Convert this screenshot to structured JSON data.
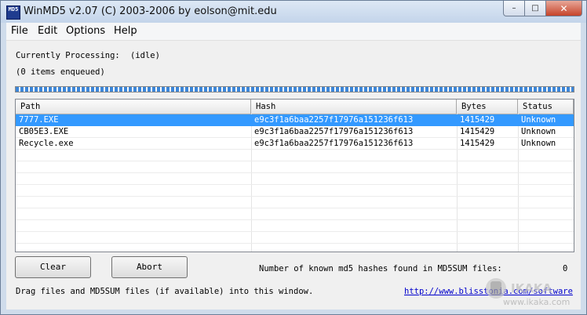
{
  "window": {
    "title": "WinMD5 v2.07 (C) 2003-2006 by eolson@mit.edu",
    "app_icon_text": "MD5"
  },
  "menu": [
    "File",
    "Edit",
    "Options",
    "Help"
  ],
  "status": {
    "processing_label": "Currently Processing:",
    "processing_value": "(idle)",
    "queue": "(0 items enqueued)",
    "progress_fraction": 1.0
  },
  "table": {
    "columns": [
      "Path",
      "Hash",
      "Bytes",
      "Status"
    ],
    "rows": [
      {
        "path": "7777.EXE",
        "hash": "e9c3f1a6baa2257f17976a151236f613",
        "bytes": "1415429",
        "status": "Unknown",
        "selected": true
      },
      {
        "path": "CB05E3.EXE",
        "hash": "e9c3f1a6baa2257f17976a151236f613",
        "bytes": "1415429",
        "status": "Unknown",
        "selected": false
      },
      {
        "path": "Recycle.exe",
        "hash": "e9c3f1a6baa2257f17976a151236f613",
        "bytes": "1415429",
        "status": "Unknown",
        "selected": false
      }
    ]
  },
  "buttons": {
    "clear": "Clear",
    "abort": "Abort"
  },
  "known_hashes": {
    "label": "Number of known md5 hashes found in MD5SUM files:",
    "value": "0"
  },
  "footer": {
    "hint": "Drag files and MD5SUM files (if available) into this window.",
    "link": "http://www.blisstonia.com/software"
  },
  "watermark": {
    "line1": "IKAKA",
    "line2": "www.ikaka.com"
  },
  "colors": {
    "selection": "#3399ff",
    "progress": "#3c86d8",
    "link": "#0000cc"
  }
}
